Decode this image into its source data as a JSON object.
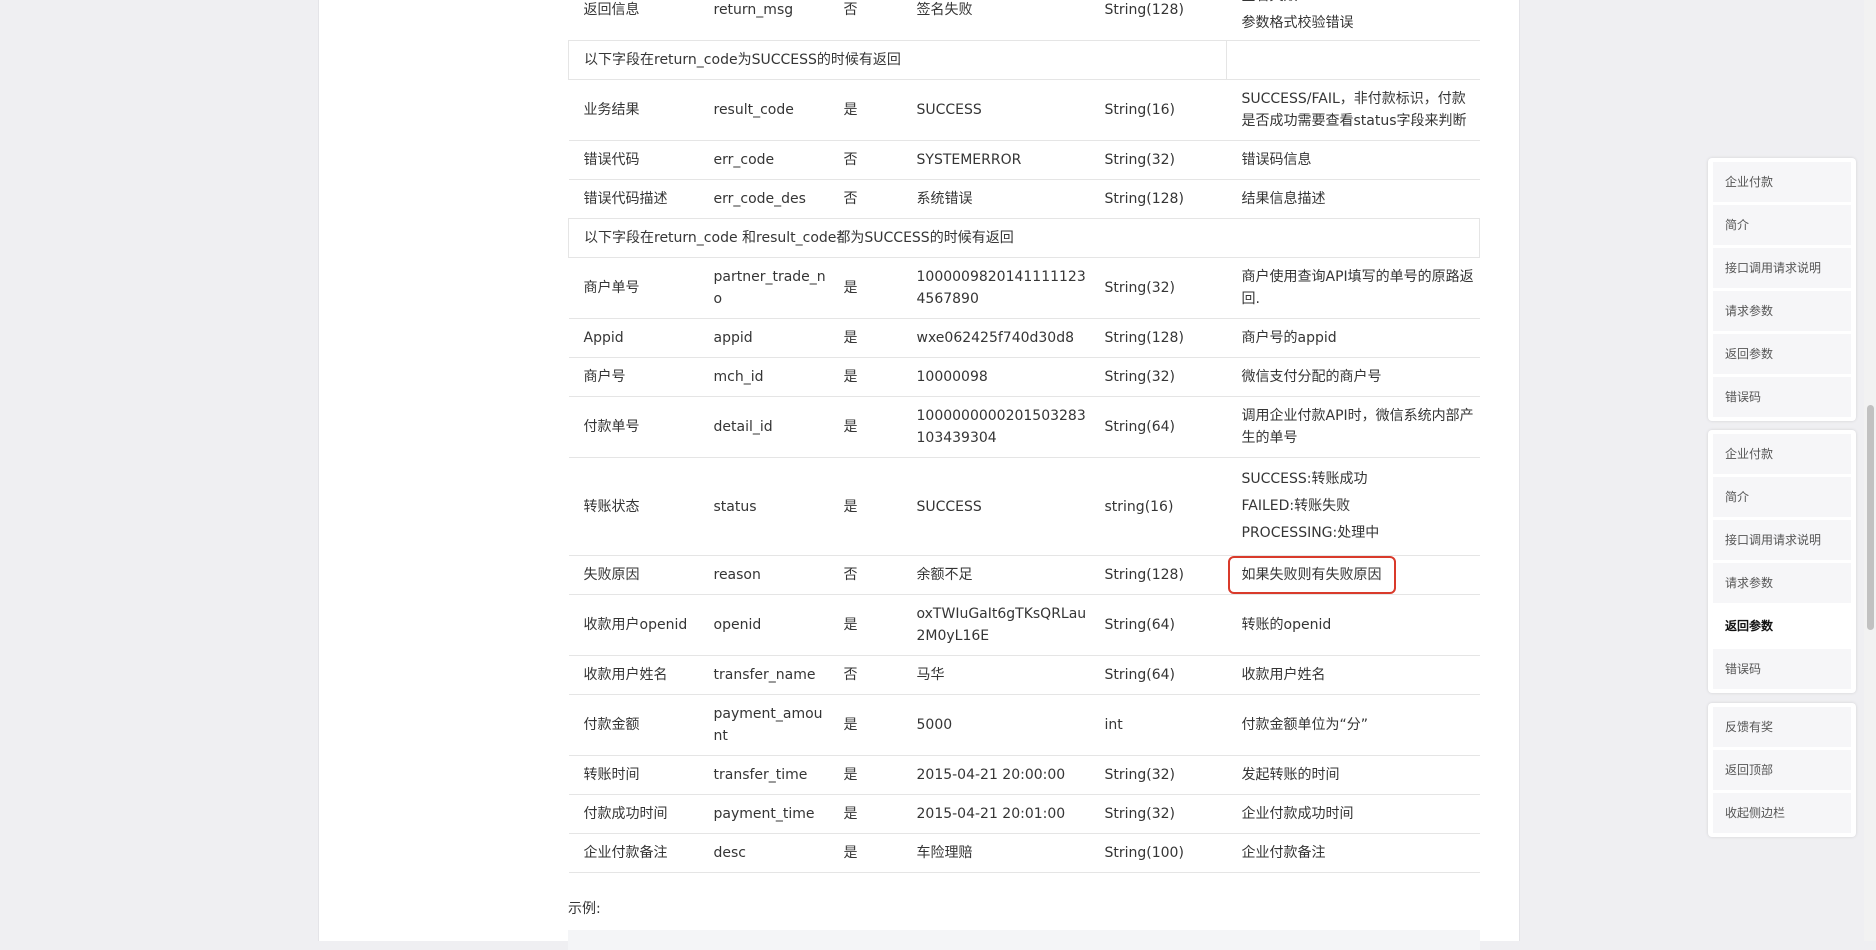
{
  "table": {
    "top_row": {
      "name": "返回信息",
      "field": "return_msg",
      "required": "否",
      "example": "签名失败",
      "type": "String(128)",
      "desc_lines": [
        "签名失败",
        "参数格式校验错误"
      ]
    },
    "note1": "以下字段在return_code为SUCCESS的时候有返回",
    "group1": [
      {
        "name": "业务结果",
        "field": "result_code",
        "required": "是",
        "example": "SUCCESS",
        "type": "String(16)",
        "desc": "SUCCESS/FAIL，非付款标识，付款是否成功需要查看status字段来判断"
      },
      {
        "name": "错误代码",
        "field": "err_code",
        "required": "否",
        "example": "SYSTEMERROR",
        "type": "String(32)",
        "desc": "错误码信息"
      },
      {
        "name": "错误代码描述",
        "field": "err_code_des",
        "required": "否",
        "example": "系统错误",
        "type": "String(128)",
        "desc": "结果信息描述"
      }
    ],
    "note2": "以下字段在return_code 和result_code都为SUCCESS的时候有返回",
    "group2a": [
      {
        "name": "商户单号",
        "field": "partner_trade_no",
        "required": "是",
        "example": "10000098201411111234567890",
        "type": "String(32)",
        "desc": "商户使用查询API填写的单号的原路返回."
      },
      {
        "name": "Appid",
        "field": "appid",
        "required": "是",
        "example": "wxe062425f740d30d8",
        "type": "String(128)",
        "desc": "商户号的appid"
      },
      {
        "name": "商户号",
        "field": "mch_id",
        "required": "是",
        "example": "10000098",
        "type": "String(32)",
        "desc": "微信支付分配的商户号"
      },
      {
        "name": "付款单号",
        "field": "detail_id",
        "required": "是",
        "example": "1000000000201503283103439304",
        "type": "String(64)",
        "desc": "调用企业付款API时，微信系统内部产生的单号"
      }
    ],
    "status_row": {
      "name": "转账状态",
      "field": "status",
      "required": "是",
      "example": "SUCCESS",
      "type": "string(16)",
      "desc_lines": [
        "SUCCESS:转账成功",
        "FAILED:转账失败",
        "PROCESSING:处理中"
      ]
    },
    "reason_row": {
      "name": "失败原因",
      "field": "reason",
      "required": "否",
      "example": "余额不足",
      "type": "String(128)",
      "desc": "如果失败则有失败原因"
    },
    "group2b": [
      {
        "name": "收款用户openid",
        "field": "openid",
        "required": "是",
        "example": "oxTWIuGaIt6gTKsQRLau2M0yL16E",
        "type": "String(64)",
        "desc": "转账的openid"
      },
      {
        "name": "收款用户姓名",
        "field": "transfer_name",
        "required": "否",
        "example": "马华",
        "type": "String(64)",
        "desc": "收款用户姓名"
      },
      {
        "name": "付款金额",
        "field": "payment_amount",
        "required": "是",
        "example": "5000",
        "type": "int",
        "desc": "付款金额单位为“分”"
      },
      {
        "name": "转账时间",
        "field": "transfer_time",
        "required": "是",
        "example": "2015-04-21 20:00:00",
        "type": "String(32)",
        "desc": "发起转账的时间"
      },
      {
        "name": "付款成功时间",
        "field": "payment_time",
        "required": "是",
        "example": "2015-04-21 20:01:00",
        "type": "String(32)",
        "desc": "企业付款成功时间"
      },
      {
        "name": "企业付款备注",
        "field": "desc",
        "required": "是",
        "example": "车险理赔",
        "type": "String(100)",
        "desc": "企业付款备注"
      }
    ]
  },
  "example_label": "示例:",
  "side_nav": {
    "group1": [
      "企业付款",
      "简介",
      "接口调用请求说明",
      "请求参数",
      "返回参数",
      "错误码"
    ],
    "group2": [
      "企业付款",
      "简介",
      "接口调用请求说明",
      "请求参数",
      "返回参数",
      "错误码"
    ],
    "group2_active_index": 4,
    "group3": [
      "反馈有奖",
      "返回顶部",
      "收起侧边栏"
    ]
  }
}
